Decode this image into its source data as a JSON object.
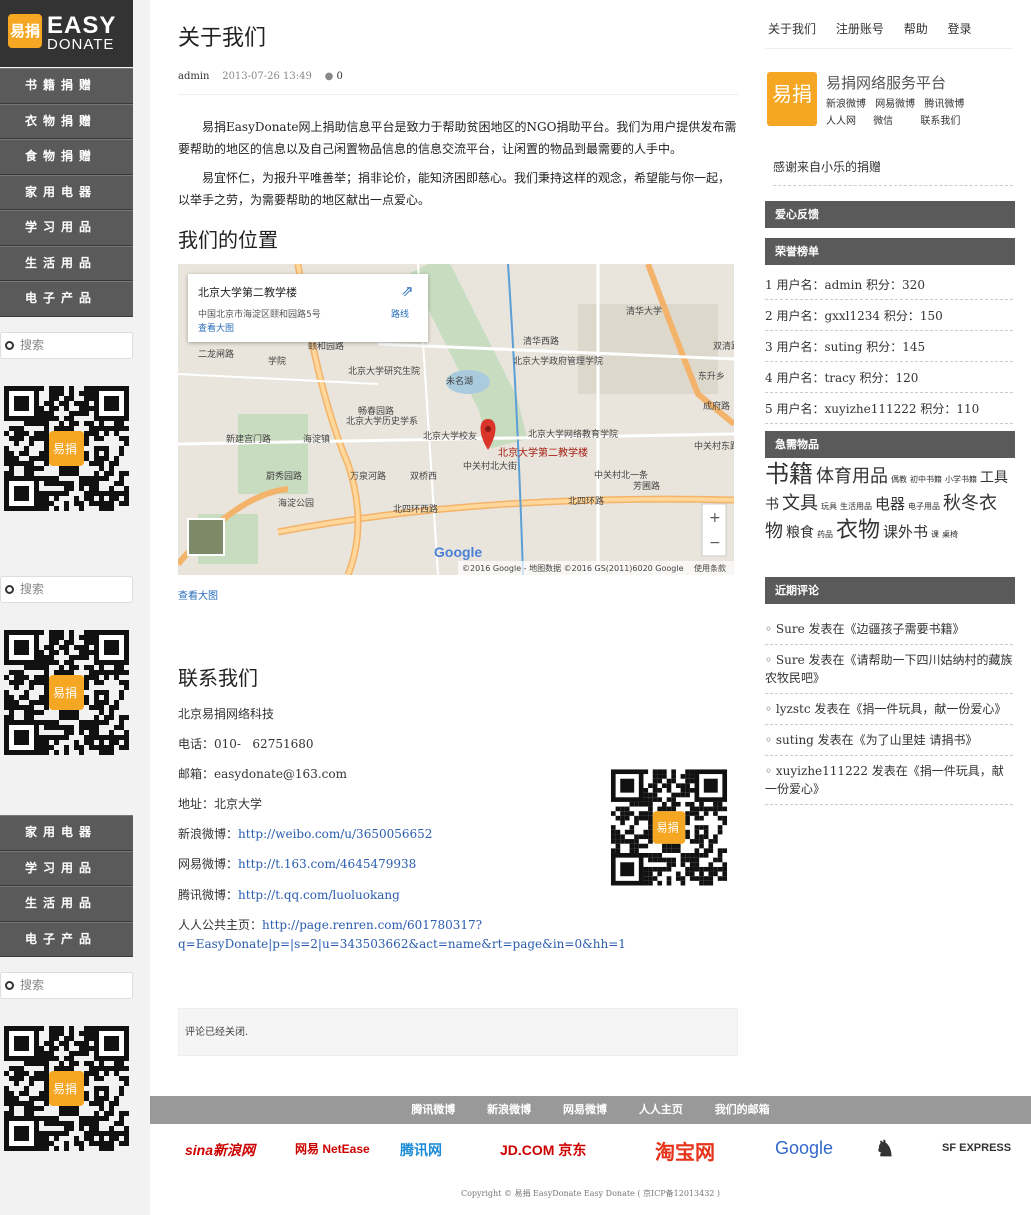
{
  "logo": {
    "mark": "易捐",
    "line1": "EASY",
    "line2": "DONATE"
  },
  "menu1": [
    "书籍捐赠",
    "衣物捐赠",
    "食物捐赠",
    "家用电器",
    "学习用品",
    "生活用品",
    "电子产品"
  ],
  "menu2": [
    "家用电器",
    "学习用品",
    "生活用品",
    "电子产品"
  ],
  "search_placeholder": "搜索",
  "article": {
    "title": "关于我们",
    "author": "admin",
    "date": "2013-07-26 13:49",
    "comments": "0",
    "para1": "易捐EasyDonate网上捐助信息平台是致力于帮助贫困地区的NGO捐助平台。我们为用户提供发布需要帮助的地区的信息以及自己闲置物品信息的信息交流平台，让闲置的物品到最需要的人手中。",
    "para2": "易宜怀仁，为报升平唯善举；捐非论价，能知济困即慈心。我们秉持这样的观念，希望能与你一起，以举手之劳，为需要帮助的地区献出一点爱心。",
    "location_title": "我们的位置",
    "view_larger": "查看大图",
    "contact_title": "联系我们",
    "company": "北京易捐网络科技",
    "phone_label": "电话：",
    "phone": "010-   62751680",
    "email_label": "邮箱：",
    "email": "easydonate@163.com",
    "address_label": "地址：",
    "address": "北京大学",
    "sina_label": "新浪微博：",
    "sina": "http://weibo.com/u/3650056652",
    "netease_label": "网易微博：",
    "netease": "http://t.163.com/4645479938",
    "tencent_label": "腾讯微博：",
    "tencent": "http://t.qq.com/luoluokang",
    "renren_label": "人人公共主页：",
    "renren1": "http://page.renren.com/601780317?",
    "renren2": "q=EasyDonate|p=|s=2|u=343503662&act=name&rt=page&in=0&hh=1",
    "closed": "评论已经关闭."
  },
  "map": {
    "card_title": "北京大学第二教学楼",
    "card_addr": "中国北京市海淀区颐和园路5号",
    "card_link": "查看大图",
    "route": "路线",
    "pin": "北京大学第二教学楼",
    "labels": [
      "清华大学",
      "北京大学政府管理学院",
      "北京大学研究生院",
      "未名湖",
      "畅春园路",
      "北京大学历史学系",
      "北京大学校友",
      "北京大学网络教育学院",
      "北四环西路",
      "北四环路",
      "海淀公园",
      "万泉河路",
      "新建宫门路",
      "颐和园路",
      "二龙闸路",
      "中关村北一条",
      "成府路",
      "清华西路",
      "双清路",
      "中关村东路",
      "海淀镇",
      "学院",
      "东升乡",
      "中关村北大街",
      "双桥西",
      "蔚秀园路",
      "芳圃路"
    ],
    "copyright": "©2016 Google - 地图数据 ©2016 GS(2011)6020 Google",
    "terms": "使用条款",
    "google": "Google",
    "zoom_in": "+",
    "zoom_out": "−"
  },
  "right": {
    "nav": [
      "关于我们",
      "注册账号",
      "帮助",
      "登录"
    ],
    "platform": "易捐网络服务平台",
    "shares": [
      "新浪微博",
      "网易微博",
      "腾讯微博",
      "人人网",
      "微信",
      "联系我们"
    ],
    "thanks": "感谢来自小乐的捐赠",
    "feedback": "爱心反馈",
    "honor": "荣誉榜单",
    "rank": [
      "1 用户名：admin 积分：320",
      "2 用户名：gxxl1234 积分：150",
      "3 用户名：suting 积分：145",
      "4 用户名：tracy 积分：120",
      "5 用户名：xuyizhe111222 积分：110"
    ],
    "urgent": "急需物品",
    "tags": [
      {
        "t": "书籍",
        "s": 24
      },
      {
        "t": "体育用品",
        "s": 18
      },
      {
        "t": "偶教",
        "s": 8
      },
      {
        "t": "初中书籍",
        "s": 8
      },
      {
        "t": "小学书籍",
        "s": 8
      },
      {
        "t": "工具书",
        "s": 14
      },
      {
        "t": "文具",
        "s": 18
      },
      {
        "t": "玩具",
        "s": 8
      },
      {
        "t": "生活用品",
        "s": 8
      },
      {
        "t": "电器",
        "s": 15
      },
      {
        "t": "电子用品",
        "s": 8
      },
      {
        "t": "秋冬衣物",
        "s": 18
      },
      {
        "t": "粮食",
        "s": 14
      },
      {
        "t": "药品",
        "s": 8
      },
      {
        "t": "衣物",
        "s": 22
      },
      {
        "t": "课外书",
        "s": 15
      },
      {
        "t": "课",
        "s": 8
      },
      {
        "t": "桌椅",
        "s": 8
      }
    ],
    "recent": "近期评论",
    "comments": [
      "Sure 发表在《边疆孩子需要书籍》",
      "Sure 发表在《请帮助一下四川姑纳村的藏族农牧民吧》",
      "lyzstc 发表在《捐一件玩具，献一份爱心》",
      "suting 发表在《为了山里娃 请捐书》",
      "xuyizhe111222 发表在《捐一件玩具，献一份爱心》"
    ]
  },
  "footer": {
    "links": [
      "腾讯微博",
      "新浪微博",
      "网易微博",
      "人人主页",
      "我们的邮箱"
    ],
    "logos": [
      "sina新浪网",
      "网易 NetEase",
      "腾讯网",
      "JD.COM 京东",
      "淘宝网",
      "Google",
      "",
      "SF EXPRESS"
    ],
    "copyright": "Copyright © 易捐 EasyDonate Easy Donate ( 京ICP备12013432 )"
  },
  "colors": {
    "menu": "#5a5a5a",
    "accent": "#f5a623",
    "link": "#2a5db0",
    "footer": "#999999"
  }
}
